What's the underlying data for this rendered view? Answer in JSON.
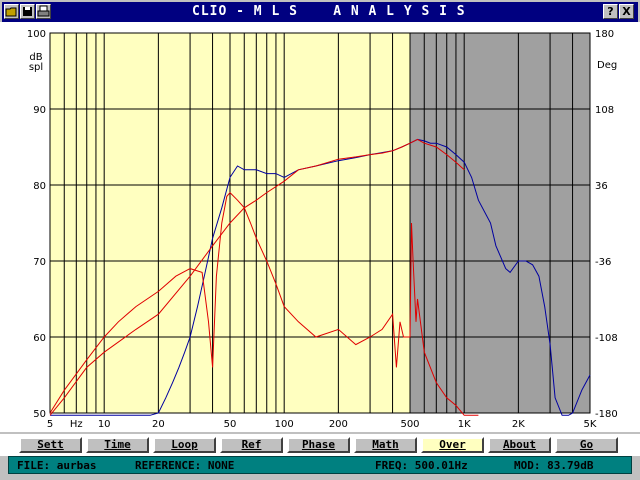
{
  "window": {
    "title": "CLIO - M L S    A N A L Y S I S",
    "help_glyph": "?",
    "close_glyph": "X"
  },
  "chart_data": {
    "type": "line",
    "x_scale": "log",
    "xlim": [
      5,
      5000
    ],
    "ylim_left": [
      50,
      100
    ],
    "ylim_right": [
      -180,
      180
    ],
    "left_unit": [
      "dB",
      "spl"
    ],
    "right_unit": "Deg",
    "x_ticks": [
      {
        "v": 5,
        "label": "5"
      },
      {
        "v": 7,
        "label": "Hz"
      },
      {
        "v": 10,
        "label": "10"
      },
      {
        "v": 20,
        "label": "20"
      },
      {
        "v": 50,
        "label": "50"
      },
      {
        "v": 100,
        "label": "100"
      },
      {
        "v": 200,
        "label": "200"
      },
      {
        "v": 500,
        "label": "500"
      },
      {
        "v": 1000,
        "label": "1K"
      },
      {
        "v": 2000,
        "label": "2K"
      },
      {
        "v": 5000,
        "label": "5K"
      }
    ],
    "y_ticks_left": [
      "100",
      "90",
      "80",
      "70",
      "60",
      "50"
    ],
    "y_ticks_right": [
      "180",
      "108",
      "36",
      "-36",
      "-108",
      "-180"
    ],
    "gated_region_start_hz": 500,
    "series": [
      {
        "color": "#0000a0",
        "x": [
          5,
          6,
          8,
          10,
          12,
          14,
          15,
          16,
          18,
          20,
          22,
          24,
          26,
          28,
          30,
          33,
          36,
          40,
          45,
          50,
          55,
          60,
          70,
          80,
          90,
          100,
          120,
          150,
          200,
          250,
          300,
          400,
          450,
          500,
          550,
          600,
          650,
          700,
          800,
          900,
          1000,
          1100,
          1200,
          1400,
          1500,
          1700,
          1800,
          2000,
          2200,
          2400,
          2600,
          2800,
          3000,
          3200,
          3500,
          3800,
          4000,
          4500,
          5000
        ],
        "y": [
          45,
          46,
          46,
          47,
          49,
          48,
          49,
          49,
          49,
          50,
          52,
          54,
          56,
          58,
          60,
          64,
          68,
          73,
          77,
          81,
          82.5,
          82,
          82,
          81.5,
          81.5,
          81,
          82,
          82.5,
          83.2,
          83.6,
          84,
          84.5,
          85,
          85.5,
          86,
          85.8,
          85.5,
          85.5,
          85,
          84,
          83,
          81,
          78,
          75,
          72,
          69,
          68.5,
          70,
          70,
          69.5,
          68,
          64,
          59,
          52,
          48,
          47,
          50,
          53,
          55
        ]
      },
      {
        "color": "#e00000",
        "x": [
          5,
          6,
          8,
          10,
          12,
          15,
          20,
          25,
          30,
          35,
          38,
          40,
          42,
          45,
          48,
          50,
          55,
          60,
          65,
          70,
          80,
          90,
          100,
          120,
          150,
          200,
          250,
          300,
          350,
          400,
          420,
          440,
          460,
          480,
          500,
          510,
          520,
          540,
          550,
          600,
          700,
          800,
          900,
          1000,
          1100,
          1200
        ],
        "y": [
          50,
          53,
          57,
          60,
          62,
          64,
          66,
          68,
          69,
          68.5,
          62,
          56,
          68,
          75,
          78.5,
          79,
          78,
          77,
          75,
          73,
          70,
          67,
          64,
          62,
          60,
          61,
          59,
          60,
          61,
          63,
          56,
          62,
          60,
          60,
          60,
          75,
          70,
          62,
          65,
          58,
          54,
          52,
          51,
          47,
          45,
          44
        ]
      },
      {
        "color": "#e00000",
        "x": [
          5,
          6,
          8,
          10,
          15,
          20,
          30,
          40,
          50,
          60,
          70,
          80,
          100,
          120,
          150,
          200,
          250,
          300,
          350,
          400,
          450,
          500,
          550,
          600,
          700,
          800,
          900,
          1000
        ],
        "y": [
          48,
          52,
          56,
          58,
          61,
          63,
          68,
          72,
          75,
          77,
          78,
          79,
          80.5,
          82,
          82.5,
          83.4,
          83.7,
          84,
          84.2,
          84.5,
          85,
          85.5,
          86,
          85.5,
          85,
          84,
          83,
          82
        ]
      }
    ]
  },
  "buttons": [
    {
      "label": "Sett",
      "active": false
    },
    {
      "label": "Time",
      "active": false
    },
    {
      "label": "Loop",
      "active": false
    },
    {
      "label": "Ref",
      "active": false
    },
    {
      "label": "Phase",
      "active": false
    },
    {
      "label": "Math",
      "active": false
    },
    {
      "label": "Over",
      "active": true
    },
    {
      "label": "About",
      "active": false
    },
    {
      "label": "Go",
      "active": false
    }
  ],
  "status": {
    "file": "FILE: aurbas",
    "reference": "REFERENCE: NONE",
    "freq": "FREQ: 500.01Hz",
    "mod": "MOD: 83.79dB"
  }
}
